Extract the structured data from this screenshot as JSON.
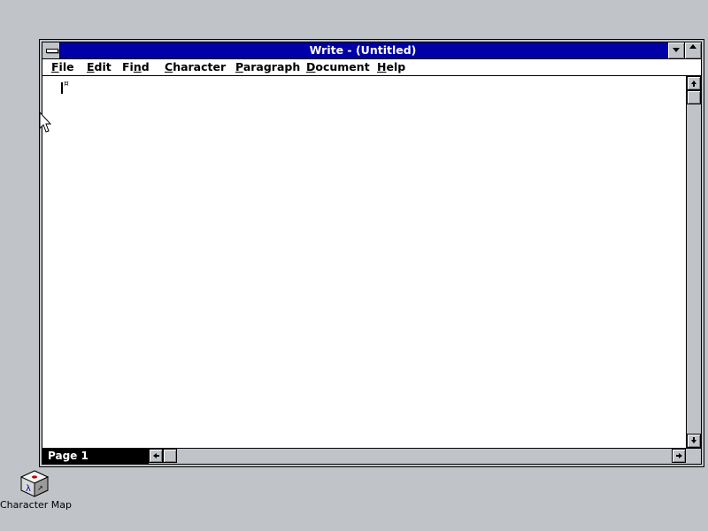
{
  "window": {
    "title": "Write - (Untitled)"
  },
  "menu": {
    "items": [
      {
        "pre": "",
        "ul": "F",
        "post": "ile"
      },
      {
        "pre": "",
        "ul": "E",
        "post": "dit"
      },
      {
        "pre": "Fi",
        "ul": "n",
        "post": "d"
      },
      {
        "pre": "",
        "ul": "C",
        "post": "haracter"
      },
      {
        "pre": "",
        "ul": "P",
        "post": "aragraph"
      },
      {
        "pre": "",
        "ul": "D",
        "post": "ocument"
      },
      {
        "pre": "",
        "ul": "H",
        "post": "elp"
      }
    ]
  },
  "document": {
    "end_mark": "¤"
  },
  "status": {
    "page": "Page 1"
  },
  "desktop": {
    "icons": [
      {
        "label": "Character Map",
        "icon": "character-map-icon"
      }
    ]
  },
  "colors": {
    "desktop": "#c0c4c8",
    "titlebar_active": "#0000a8",
    "window_bg": "#ffffff"
  }
}
